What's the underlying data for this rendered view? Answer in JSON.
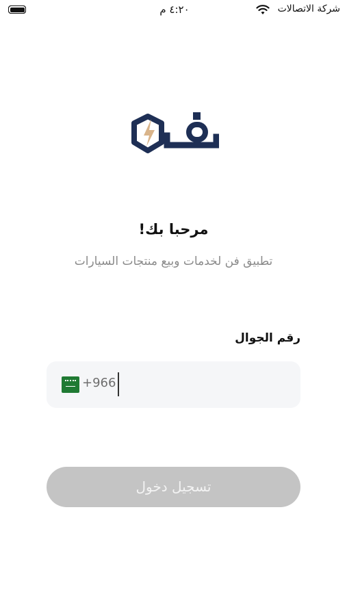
{
  "status_bar": {
    "carrier": "شركة الاتصالات",
    "time": "٤:٢٠ م"
  },
  "welcome": {
    "title": "مرحبا بك!",
    "subtitle": "تطبيق فن لخدمات وبيع منتجات السيارات"
  },
  "phone": {
    "label": "رقم الجوال",
    "country_code": "+966",
    "value": ""
  },
  "login_button": {
    "label": "تسجيل دخول"
  },
  "colors": {
    "logo_navy": "#1e2f55",
    "logo_bolt": "#d9b48a",
    "field_bg": "#f5f6f8",
    "button_disabled": "#c4c4c4"
  },
  "icons": [
    "battery-icon",
    "wifi-icon",
    "app-logo",
    "saudi-flag-icon"
  ]
}
